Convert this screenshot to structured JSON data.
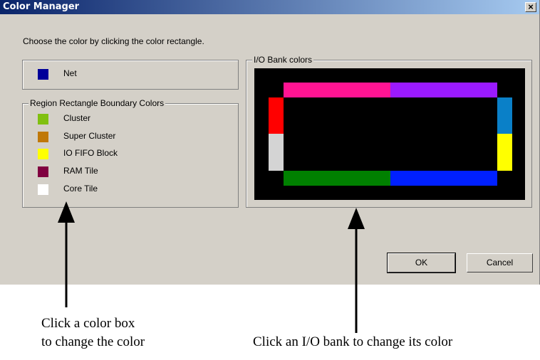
{
  "window": {
    "title": "Color Manager",
    "close_label": "×"
  },
  "instruction": "Choose the color by clicking the color rectangle.",
  "net": {
    "label": "Net",
    "color": "#000099"
  },
  "region_group": {
    "title": "Region Rectangle Boundary Colors",
    "items": [
      {
        "label": "Cluster",
        "color": "#80c010"
      },
      {
        "label": "Super Cluster",
        "color": "#c07808"
      },
      {
        "label": "IO FIFO Block",
        "color": "#ffff00"
      },
      {
        "label": "RAM Tile",
        "color": "#800040"
      },
      {
        "label": "Core Tile",
        "color": "#ffffff"
      }
    ]
  },
  "io_group": {
    "title": "I/O Bank colors",
    "background": "#000000",
    "banks": {
      "top_left": "#ff1493",
      "top_right": "#9b1aff",
      "bottom_left": "#008000",
      "bottom_right": "#0020ff",
      "left_top": "#ff0000",
      "left_bottom": "#d4d4d4",
      "right_top": "#0a80c8",
      "right_bottom": "#ffff00"
    }
  },
  "buttons": {
    "ok": "OK",
    "cancel": "Cancel"
  },
  "annotations": {
    "left_line1": "Click a color box",
    "left_line2": "to change the color",
    "right": "Click an I/O bank to change its color"
  }
}
